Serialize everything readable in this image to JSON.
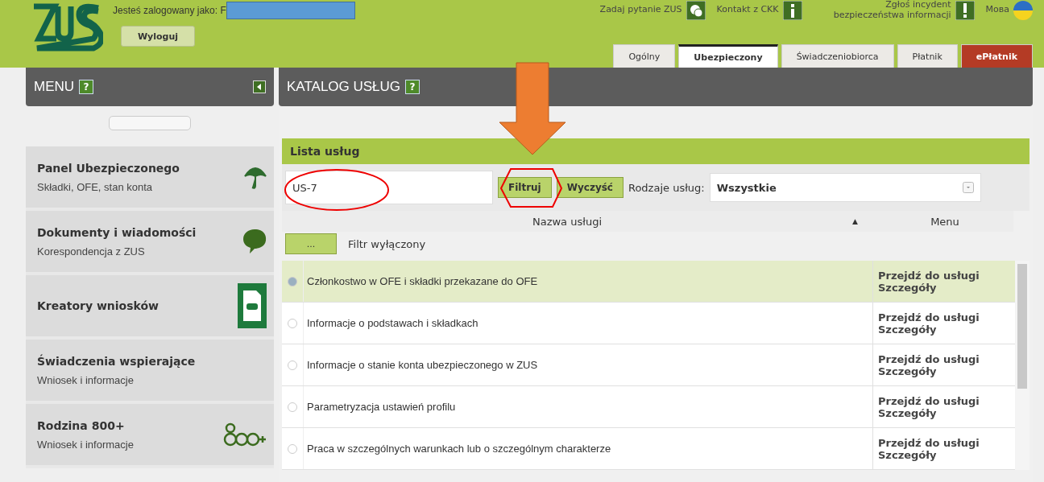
{
  "header": {
    "logged_in_label": "Jesteś zalogowany jako: F",
    "logout_button": "Wyloguj",
    "links": [
      {
        "kind": "question",
        "label": "Zadaj pytanie ZUS"
      },
      {
        "kind": "info",
        "label": "Kontakt z CKK"
      },
      {
        "kind": "alert",
        "label": "Zgłoś incydent bezpieczeństwa informacji"
      },
      {
        "kind": "flag",
        "label": "Мова"
      }
    ],
    "tabs": [
      {
        "label": "Ogólny",
        "selected": false,
        "kind": "normal"
      },
      {
        "label": "Ubezpieczony",
        "selected": true,
        "kind": "normal"
      },
      {
        "label": "Świadczeniobiorca",
        "selected": false,
        "kind": "normal"
      },
      {
        "label": "Płatnik",
        "selected": false,
        "kind": "normal"
      },
      {
        "label": "ePłatnik",
        "selected": false,
        "kind": "accent"
      }
    ]
  },
  "sidebar": {
    "title": "MENU",
    "help": "?",
    "items": [
      {
        "title": "Panel Ubezpieczonego",
        "subtitle": "Składki, OFE, stan konta",
        "kind": "umbrella"
      },
      {
        "title": "Dokumenty i wiadomości",
        "subtitle": "Korespondencja z ZUS",
        "kind": "bubble"
      },
      {
        "title": "Kreatory wniosków",
        "kind": "document"
      },
      {
        "title": "Świadczenia wspierające",
        "subtitle": "Wniosek i informacje"
      },
      {
        "title": "Rodzina 800+",
        "subtitle": "Wniosek i informacje",
        "kind": "r800"
      }
    ]
  },
  "catalog": {
    "title": "KATALOG USŁUG",
    "help": "?",
    "list_title": "Lista usług",
    "search_value": "US-7",
    "filter_button": "Filtruj",
    "clear_button": "Wyczyść",
    "type_label": "Rodzaje usług:",
    "type_value": "Wszystkie",
    "columns": [
      "Nazwa usługi",
      "Menu"
    ],
    "sort_mark": "▲",
    "filter_toggle": "...",
    "filter_status": "Filtr wyłączony",
    "rows": [
      {
        "name": "Członkostwo w OFE i składki przekazane do OFE",
        "link": "Przejdź do usługi",
        "details": "Szczegóły",
        "selected": true
      },
      {
        "name": "Informacje o podstawach i składkach",
        "link": "Przejdź do usługi",
        "details": "Szczegóły",
        "selected": false
      },
      {
        "name": "Informacje o stanie konta ubezpieczonego w ZUS",
        "link": "Przejdź do usługi",
        "details": "Szczegóły",
        "selected": false
      },
      {
        "name": "Parametryzacja ustawień profilu",
        "link": "Przejdź do usługi",
        "details": "Szczegóły",
        "selected": false
      },
      {
        "name": "Praca w szczególnych warunkach lub o szczególnym charakterze",
        "link": "Przejdź do usługi",
        "details": "Szczegóły",
        "selected": false
      }
    ]
  }
}
